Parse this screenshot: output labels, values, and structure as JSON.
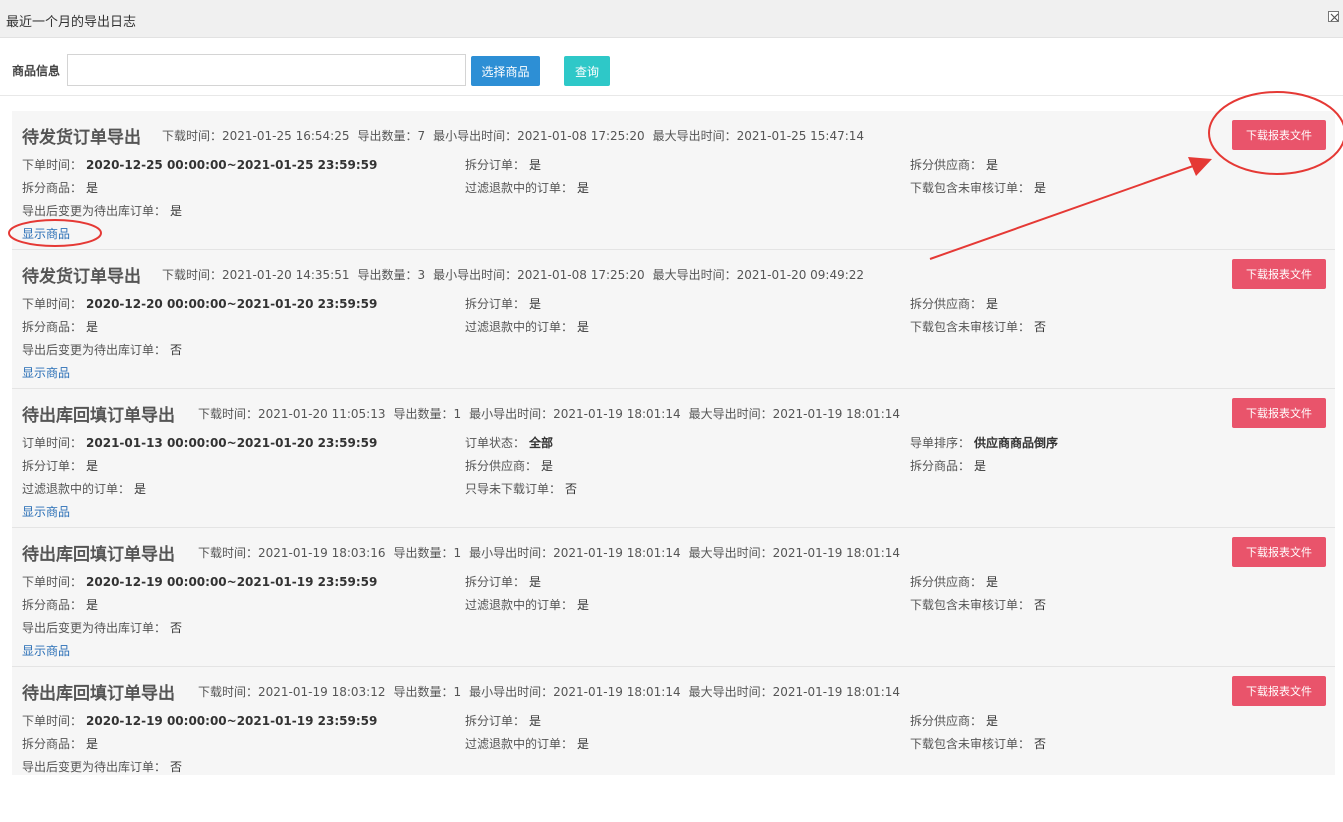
{
  "window": {
    "title": "最近一个月的导出日志"
  },
  "search": {
    "label": "商品信息",
    "value": "",
    "placeholder": "",
    "select_button": "选择商品",
    "query_button": "查询"
  },
  "download_label": "下载报表文件",
  "show_products_label": "显示商品",
  "meta_labels": {
    "download_time": "下载时间：",
    "export_count": "导出数量：",
    "min_time": "最小导出时间：",
    "max_time": "最大导出时间："
  },
  "records": [
    {
      "title": "待发货订单导出",
      "download_time": "2021-01-25 16:54:25",
      "export_count": "7",
      "min_time": "2021-01-08 17:25:20",
      "max_time": "2021-01-25 15:47:14",
      "fields": [
        {
          "label": "下单时间：",
          "value": "2020-12-25 00:00:00~2021-01-25 23:59:59"
        },
        {
          "label": "拆分订单：",
          "value": "是"
        },
        {
          "label": "拆分供应商：",
          "value": "是"
        },
        {
          "label": "拆分商品：",
          "value": "是"
        },
        {
          "label": "过滤退款中的订单：",
          "value": "是"
        },
        {
          "label": "下载包含未审核订单：",
          "value": "是"
        },
        {
          "label": "导出后变更为待出库订单：",
          "value": "是"
        }
      ]
    },
    {
      "title": "待发货订单导出",
      "download_time": "2021-01-20 14:35:51",
      "export_count": "3",
      "min_time": "2021-01-08 17:25:20",
      "max_time": "2021-01-20 09:49:22",
      "fields": [
        {
          "label": "下单时间：",
          "value": "2020-12-20 00:00:00~2021-01-20 23:59:59"
        },
        {
          "label": "拆分订单：",
          "value": "是"
        },
        {
          "label": "拆分供应商：",
          "value": "是"
        },
        {
          "label": "拆分商品：",
          "value": "是"
        },
        {
          "label": "过滤退款中的订单：",
          "value": "是"
        },
        {
          "label": "下载包含未审核订单：",
          "value": "否"
        },
        {
          "label": "导出后变更为待出库订单：",
          "value": "否"
        }
      ]
    },
    {
      "title": "待出库回填订单导出",
      "download_time": "2021-01-20 11:05:13",
      "export_count": "1",
      "min_time": "2021-01-19 18:01:14",
      "max_time": "2021-01-19 18:01:14",
      "fields": [
        {
          "label": "订单时间：",
          "value": "2021-01-13 00:00:00~2021-01-20 23:59:59"
        },
        {
          "label": "订单状态：",
          "value": "全部"
        },
        {
          "label": "导单排序：",
          "value": "供应商商品倒序"
        },
        {
          "label": "拆分订单：",
          "value": "是"
        },
        {
          "label": "拆分供应商：",
          "value": "是"
        },
        {
          "label": "拆分商品：",
          "value": "是"
        },
        {
          "label": "过滤退款中的订单：",
          "value": "是"
        },
        {
          "label": "只导未下载订单：",
          "value": "否"
        }
      ]
    },
    {
      "title": "待出库回填订单导出",
      "download_time": "2021-01-19 18:03:16",
      "export_count": "1",
      "min_time": "2021-01-19 18:01:14",
      "max_time": "2021-01-19 18:01:14",
      "fields": [
        {
          "label": "下单时间：",
          "value": "2020-12-19 00:00:00~2021-01-19 23:59:59"
        },
        {
          "label": "拆分订单：",
          "value": "是"
        },
        {
          "label": "拆分供应商：",
          "value": "是"
        },
        {
          "label": "拆分商品：",
          "value": "是"
        },
        {
          "label": "过滤退款中的订单：",
          "value": "是"
        },
        {
          "label": "下载包含未审核订单：",
          "value": "否"
        },
        {
          "label": "导出后变更为待出库订单：",
          "value": "否"
        }
      ]
    },
    {
      "title": "待出库回填订单导出",
      "download_time": "2021-01-19 18:03:12",
      "export_count": "1",
      "min_time": "2021-01-19 18:01:14",
      "max_time": "2021-01-19 18:01:14",
      "fields": [
        {
          "label": "下单时间：",
          "value": "2020-12-19 00:00:00~2021-01-19 23:59:59"
        },
        {
          "label": "拆分订单：",
          "value": "是"
        },
        {
          "label": "拆分供应商：",
          "value": "是"
        },
        {
          "label": "拆分商品：",
          "value": "是"
        },
        {
          "label": "过滤退款中的订单：",
          "value": "是"
        },
        {
          "label": "下载包含未审核订单：",
          "value": "否"
        },
        {
          "label": "导出后变更为待出库订单：",
          "value": "否"
        }
      ]
    }
  ],
  "colors": {
    "primary_button": "#2d8fd5",
    "query_button": "#2ec8c8",
    "download_button": "#e9546b",
    "link": "#2a6fb6",
    "annotation": "#e53935"
  }
}
